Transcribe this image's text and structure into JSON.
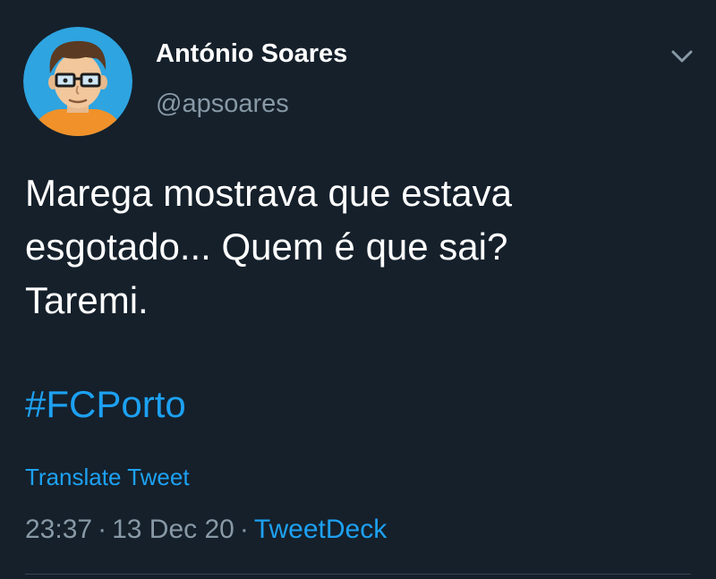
{
  "tweet": {
    "author_name": "António Soares",
    "author_handle": "@apsoares",
    "body_lines": [
      "Marega mostrava que estava",
      "esgotado... Quem é que sai?",
      "Taremi."
    ],
    "hashtag": "#FCPorto",
    "translate_label": "Translate Tweet",
    "time": "23:37",
    "date": "13 Dec 20",
    "separator": "·",
    "source": "TweetDeck"
  },
  "icons": {
    "avatar": "cartoon-avatar-icon",
    "menu": "chevron-down-icon"
  },
  "colors": {
    "background": "#15202b",
    "text": "#ffffff",
    "secondary_text": "#8899a6",
    "accent": "#1da1f2",
    "divider": "#38444d"
  }
}
